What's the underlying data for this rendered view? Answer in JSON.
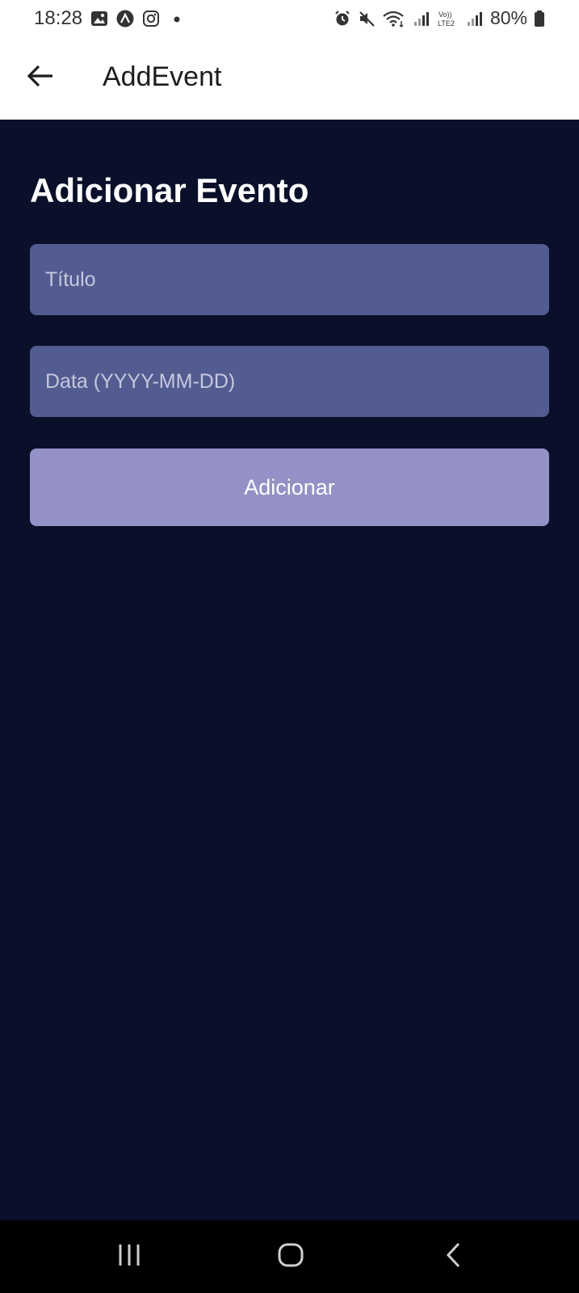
{
  "status_bar": {
    "time": "18:28",
    "left_icons": [
      "image-icon",
      "app-icon",
      "instagram-icon",
      "dot-icon"
    ],
    "right_icons": [
      "alarm-icon",
      "mute-icon",
      "wifi-icon",
      "signal-icon",
      "volte-icon",
      "signal-icon",
      "battery-icon"
    ],
    "volte_label": "Vo)) LTE2",
    "battery": "80%"
  },
  "app_bar": {
    "title": "AddEvent",
    "back_icon": "arrow-left-icon"
  },
  "main": {
    "heading": "Adicionar Evento",
    "title_field": {
      "placeholder": "Título",
      "value": ""
    },
    "date_field": {
      "placeholder": "Data (YYYY-MM-DD)",
      "value": ""
    },
    "submit_label": "Adicionar"
  },
  "nav_bar": {
    "items": [
      "recents-icon",
      "home-icon",
      "back-icon"
    ]
  },
  "colors": {
    "background": "#0a102a",
    "input": "#525c90",
    "button": "#9391c5",
    "text": "#ffffff"
  }
}
